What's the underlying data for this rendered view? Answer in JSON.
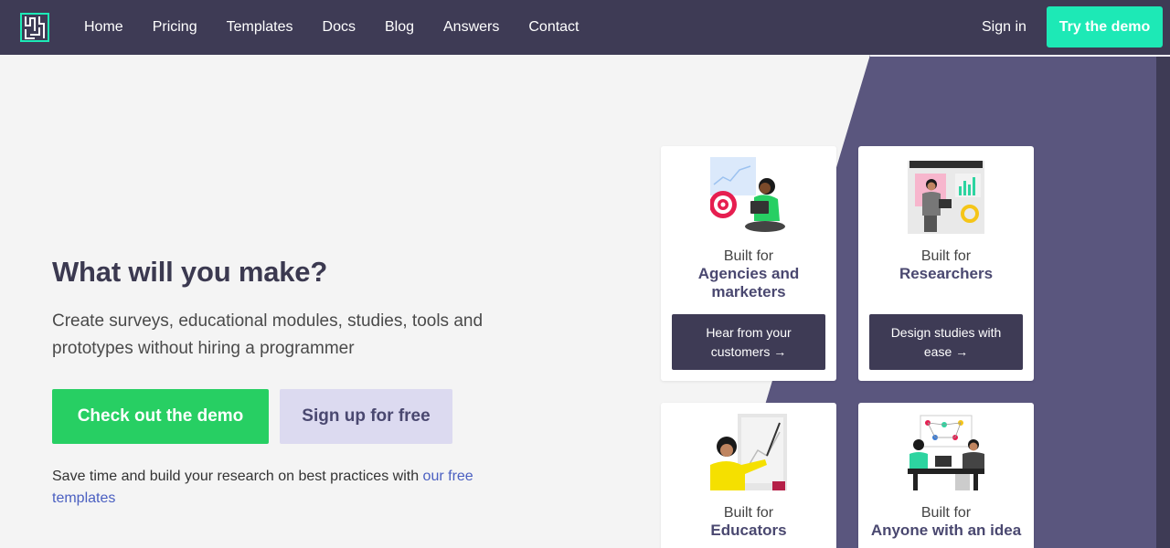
{
  "nav": {
    "links": [
      "Home",
      "Pricing",
      "Templates",
      "Docs",
      "Blog",
      "Answers",
      "Contact"
    ],
    "signin": "Sign in",
    "try_demo": "Try the demo"
  },
  "hero": {
    "title": "What will you make?",
    "subtitle": "Create surveys, educational modules, studies, tools and prototypes without hiring a programmer",
    "demo_button": "Check out the demo",
    "signup_button": "Sign up for free",
    "save_text": "Save time and build your research on best practices with ",
    "save_link": "our free templates"
  },
  "cards": [
    {
      "built": "Built for",
      "audience": "Agencies and marketers",
      "cta": "Hear from your customers →",
      "icon": "marketer-illustration"
    },
    {
      "built": "Built for",
      "audience": "Researchers",
      "cta": "Design studies with ease →",
      "icon": "researcher-illustration"
    },
    {
      "built": "Built for",
      "audience": "Educators",
      "icon": "educator-illustration"
    },
    {
      "built": "Built for",
      "audience": "Anyone with an idea",
      "icon": "team-illustration"
    }
  ],
  "colors": {
    "nav_bg": "#3e3b55",
    "accent_teal": "#1de9b6",
    "accent_green": "#27cf63",
    "secondary_button": "#dcdaf0",
    "decor_purple": "#5a567e",
    "link": "#4a5fc1"
  }
}
